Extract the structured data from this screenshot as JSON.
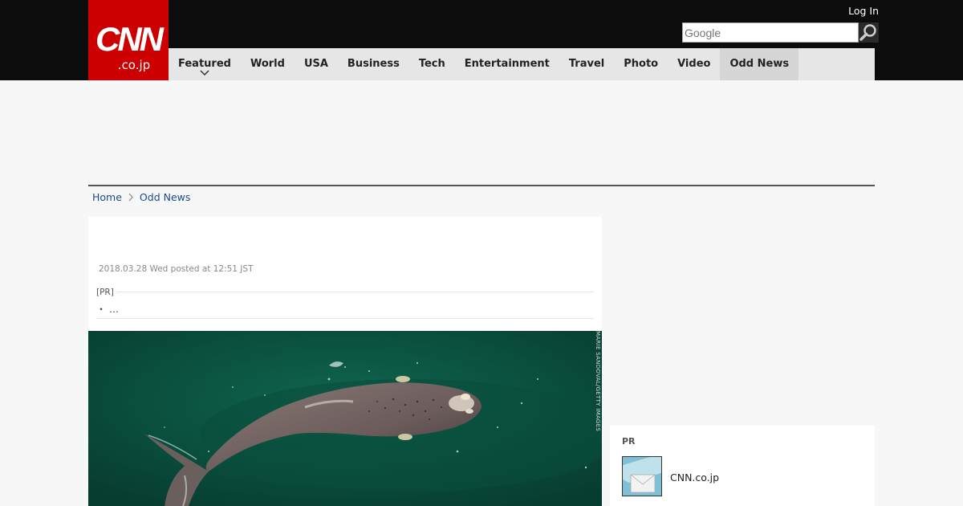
{
  "header": {
    "logo_main": "CNN",
    "logo_sub": ".co.jp",
    "login_label": "Log In",
    "search_placeholder": "Google"
  },
  "nav": {
    "items": [
      {
        "label": "Featured"
      },
      {
        "label": "World"
      },
      {
        "label": "USA"
      },
      {
        "label": "Business"
      },
      {
        "label": "Tech"
      },
      {
        "label": "Entertainment"
      },
      {
        "label": "Travel"
      },
      {
        "label": "Photo"
      },
      {
        "label": "Video"
      },
      {
        "label": "Odd News"
      }
    ],
    "active": "Odd News"
  },
  "breadcrumb": {
    "home": "Home",
    "current": "Odd News"
  },
  "article": {
    "date": "2018.03.28 Wed posted at 12:51 JST",
    "pr_tag": "[PR]",
    "pr_bullet": "・",
    "pr_link": "…",
    "photo_credit": "MARIE SANDOVAL/GETTY IMAGES"
  },
  "sidebar": {
    "pr_label": "PR",
    "pr_site": "CNN.co.jp"
  },
  "colors": {
    "brand_red": "#cc0000",
    "topbar": "#0c0c0c",
    "nav_bg": "#e6e6e6",
    "link": "#1a4a8a",
    "ocean": "#0b5240"
  },
  "icons": {
    "search": "magnifier-icon",
    "featured_dropdown": "chevron-down-icon",
    "breadcrumb_separator": "chevron-right-icon"
  }
}
